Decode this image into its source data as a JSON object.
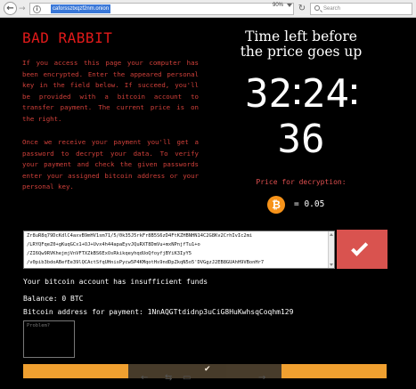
{
  "browser": {
    "url": "caforssztxqzf2nm.onion",
    "zoom": "90%",
    "search_placeholder": "Search",
    "info_glyph": "i",
    "back_glyph": "←",
    "forward_glyph": "→",
    "reload_glyph": "↻"
  },
  "left": {
    "title": "BAD RABBIT",
    "paragraph1": "If you access this page your computer has been encrypted. Enter the appeared personal key in the field below. If succeed, you'll be provided with a bitcoin account to transfer payment. The current price is on the right.",
    "paragraph2": "Once we receive your payment you'll get a password to decrypt your data. To verify your payment and check the given passwords enter your assigned bitcoin address or your personal key."
  },
  "right": {
    "time_title_line1": "Time left before",
    "time_title_line2": "the price goes up",
    "timer": {
      "d1": "32",
      "d2": "24",
      "d3": "36"
    },
    "price_label": "Price for decryption:",
    "btc_symbol": "₿",
    "price": "= 0.05"
  },
  "key_field": {
    "lines": [
      "Zr8uR8q79DcKdlC4axvB9mHV1sm71/5/0k35J5rkFr8B5S6zD4FtKZHBNHN14C2G8Kv2CrhIvIc2mi",
      "/LRYQFqeZ0+gKuqGCx1+OJ+Uvx4h44apaEyvJQuRXT8DmVu+mxNPnjfTu1+o",
      "/ZI6Qw9RVKhejmjVnVFTXZkBS6ExOsRkikqeyhqdUoQfoyfjBYiK3IyY5",
      "/v0pib3bdoABefEe39lQCActSfqUHnisPycw5P4KMqotHs9ndDpZkqN5o5'DVGgzJ2EB8GUAhH9VBonHr7"
    ]
  },
  "account": {
    "status": "Your bitcoin account has insufficient funds",
    "balance": "Balance: 0 BTC",
    "address": "Bitcoin address for payment: 1NnAQGTtdidnp3uCiG8HuKwhsqCoqhm129"
  },
  "problem_placeholder": "Problem?",
  "progress": {
    "check": "✔"
  },
  "bottom_nav": {
    "back": "←",
    "share": "⇆",
    "copy": "▭",
    "forward": "→"
  }
}
